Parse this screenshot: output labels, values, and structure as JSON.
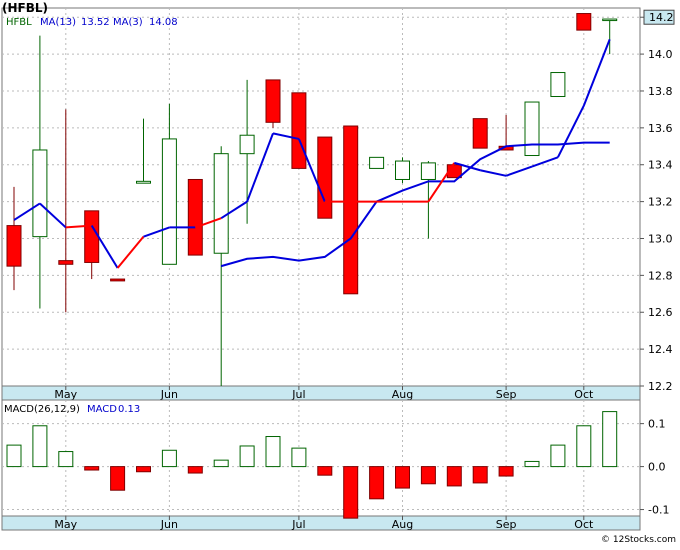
{
  "title": "(HFBL)",
  "credit": "© 12Stocks.com",
  "colors": {
    "up": "#006400",
    "down": "#ff0000",
    "ma_long": "#0000dd",
    "ma_short_down": "#ff0000",
    "axis_band": "#c8e8f0",
    "grid": "#bbbbbb",
    "legend_text": "#0000cc",
    "price_box": "#c8e8f0"
  },
  "chart_data": [
    {
      "type": "candlestick",
      "legend": [
        {
          "label": "HFBL"
        },
        {
          "label": "MA(13)",
          "value": "13.52"
        },
        {
          "label": "MA(3)",
          "value": "14.08"
        }
      ],
      "last_price": "14.2",
      "ylim": [
        12.2,
        14.25
      ],
      "yticks": [
        "12.2",
        "12.4",
        "12.6",
        "12.8",
        "13.0",
        "13.2",
        "13.4",
        "13.6",
        "13.8",
        "14.0",
        "14.2"
      ],
      "month_labels": [
        {
          "label": "May",
          "x": 2.0
        },
        {
          "label": "Jun",
          "x": 6.0
        },
        {
          "label": "Jul",
          "x": 11.0
        },
        {
          "label": "Aug",
          "x": 15.0
        },
        {
          "label": "Sep",
          "x": 19.0
        },
        {
          "label": "Oct",
          "x": 22.0
        }
      ],
      "candles": [
        {
          "x": 0,
          "o": 13.07,
          "c": 12.85,
          "h": 13.28,
          "l": 12.72
        },
        {
          "x": 1,
          "o": 13.01,
          "c": 13.48,
          "h": 14.1,
          "l": 12.62
        },
        {
          "x": 2,
          "o": 12.88,
          "c": 12.86,
          "h": 13.7,
          "l": 12.6
        },
        {
          "x": 3,
          "o": 13.15,
          "c": 12.87,
          "h": 13.15,
          "l": 12.78
        },
        {
          "x": 4,
          "o": 12.78,
          "c": 12.77,
          "h": 12.78,
          "l": 12.77
        },
        {
          "x": 5,
          "o": 13.3,
          "c": 13.31,
          "h": 13.65,
          "l": 13.3
        },
        {
          "x": 6,
          "o": 12.86,
          "c": 13.54,
          "h": 13.73,
          "l": 12.86
        },
        {
          "x": 7,
          "o": 13.32,
          "c": 12.91,
          "h": 13.32,
          "l": 12.91
        },
        {
          "x": 8,
          "o": 12.92,
          "c": 13.46,
          "h": 13.5,
          "l": 12.2
        },
        {
          "x": 9,
          "o": 13.46,
          "c": 13.56,
          "h": 13.86,
          "l": 13.08
        },
        {
          "x": 10,
          "o": 13.86,
          "c": 13.63,
          "h": 13.86,
          "l": 13.6
        },
        {
          "x": 11,
          "o": 13.79,
          "c": 13.38,
          "h": 13.79,
          "l": 13.38
        },
        {
          "x": 12,
          "o": 13.55,
          "c": 13.11,
          "h": 13.55,
          "l": 13.11
        },
        {
          "x": 13,
          "o": 13.61,
          "c": 12.7,
          "h": 13.61,
          "l": 12.7
        },
        {
          "x": 14,
          "o": 13.38,
          "c": 13.44,
          "h": 13.44,
          "l": 13.38
        },
        {
          "x": 15,
          "o": 13.32,
          "c": 13.42,
          "h": 13.44,
          "l": 13.3
        },
        {
          "x": 16,
          "o": 13.32,
          "c": 13.41,
          "h": 13.42,
          "l": 13.0
        },
        {
          "x": 17,
          "o": 13.4,
          "c": 13.33,
          "h": 13.4,
          "l": 13.33
        },
        {
          "x": 18,
          "o": 13.65,
          "c": 13.49,
          "h": 13.65,
          "l": 13.49
        },
        {
          "x": 19,
          "o": 13.5,
          "c": 13.48,
          "h": 13.67,
          "l": 13.48
        },
        {
          "x": 20,
          "o": 13.45,
          "c": 13.74,
          "h": 13.74,
          "l": 13.45
        },
        {
          "x": 21,
          "o": 13.77,
          "c": 13.9,
          "h": 13.9,
          "l": 13.77
        },
        {
          "x": 22,
          "o": 14.22,
          "c": 14.13,
          "h": 14.22,
          "l": 14.13
        },
        {
          "x": 23,
          "o": 14.19,
          "c": 14.19,
          "h": 14.19,
          "l": 14.0
        }
      ],
      "ma_long": [
        {
          "x": 0,
          "y": 12.85
        },
        {
          "x": 1,
          "y": 12.89
        },
        {
          "x": 2,
          "y": 12.9
        },
        {
          "x": 3,
          "y": 12.88
        },
        {
          "x": 4,
          "y": 12.9
        },
        {
          "x": 5,
          "y": 13.0
        },
        {
          "x": 6,
          "y": 13.2
        },
        {
          "x": 7,
          "y": 13.26
        },
        {
          "x": 8,
          "y": 13.31
        },
        {
          "x": 9,
          "y": 13.31
        },
        {
          "x": 10,
          "y": 13.43
        },
        {
          "x": 11,
          "y": 13.5
        },
        {
          "x": 12,
          "y": 13.51
        },
        {
          "x": 13,
          "y": 13.51
        },
        {
          "x": 14,
          "y": 13.52
        },
        {
          "x": 15,
          "y": 13.52
        }
      ],
      "ma_long_label": "MA(13)",
      "ma_short": [
        {
          "x": 0,
          "y": 13.1
        },
        {
          "x": 1,
          "y": 13.19
        },
        {
          "x": 2,
          "y": 13.06
        },
        {
          "x": 3,
          "y": 13.07
        },
        {
          "x": 4,
          "y": 12.84
        },
        {
          "x": 5,
          "y": 13.01
        },
        {
          "x": 6,
          "y": 13.06
        },
        {
          "x": 7,
          "y": 13.06
        },
        {
          "x": 8,
          "y": 13.11
        },
        {
          "x": 9,
          "y": 13.2
        },
        {
          "x": 10,
          "y": 13.57
        },
        {
          "x": 11,
          "y": 13.54
        },
        {
          "x": 12,
          "y": 13.2
        },
        {
          "x": 13,
          "y": 13.2
        },
        {
          "x": 14,
          "y": 13.2
        },
        {
          "x": 15,
          "y": 13.2
        },
        {
          "x": 16,
          "y": 13.2
        },
        {
          "x": 17,
          "y": 13.41
        },
        {
          "x": 18,
          "y": 13.37
        },
        {
          "x": 19,
          "y": 13.34
        },
        {
          "x": 20,
          "y": 13.39
        },
        {
          "x": 21,
          "y": 13.44
        },
        {
          "x": 22,
          "y": 13.72
        },
        {
          "x": 23,
          "y": 14.08
        }
      ],
      "ma_short_up_ranges": [
        [
          0,
          1
        ],
        [
          3,
          3
        ],
        [
          5,
          6
        ],
        [
          8,
          11
        ],
        [
          17,
          23
        ]
      ]
    },
    {
      "type": "bar",
      "legend": [
        {
          "label": "MACD(26,12,9)"
        },
        {
          "label": "MACD",
          "value": "0.13"
        }
      ],
      "ylim": [
        -0.115,
        0.155
      ],
      "yticks": [
        "0.1",
        "0.0",
        "-0.1"
      ],
      "values": [
        0.05,
        0.095,
        0.035,
        -0.008,
        -0.055,
        -0.012,
        0.038,
        -0.015,
        0.015,
        0.048,
        0.07,
        0.043,
        -0.02,
        -0.12,
        -0.075,
        -0.05,
        -0.04,
        -0.045,
        -0.038,
        -0.022,
        0.012,
        0.05,
        0.095,
        0.128
      ],
      "month_labels": [
        {
          "label": "May",
          "x": 2.0
        },
        {
          "label": "Jun",
          "x": 6.0
        },
        {
          "label": "Jul",
          "x": 11.0
        },
        {
          "label": "Aug",
          "x": 15.0
        },
        {
          "label": "Sep",
          "x": 19.0
        },
        {
          "label": "Oct",
          "x": 22.0
        }
      ]
    }
  ]
}
